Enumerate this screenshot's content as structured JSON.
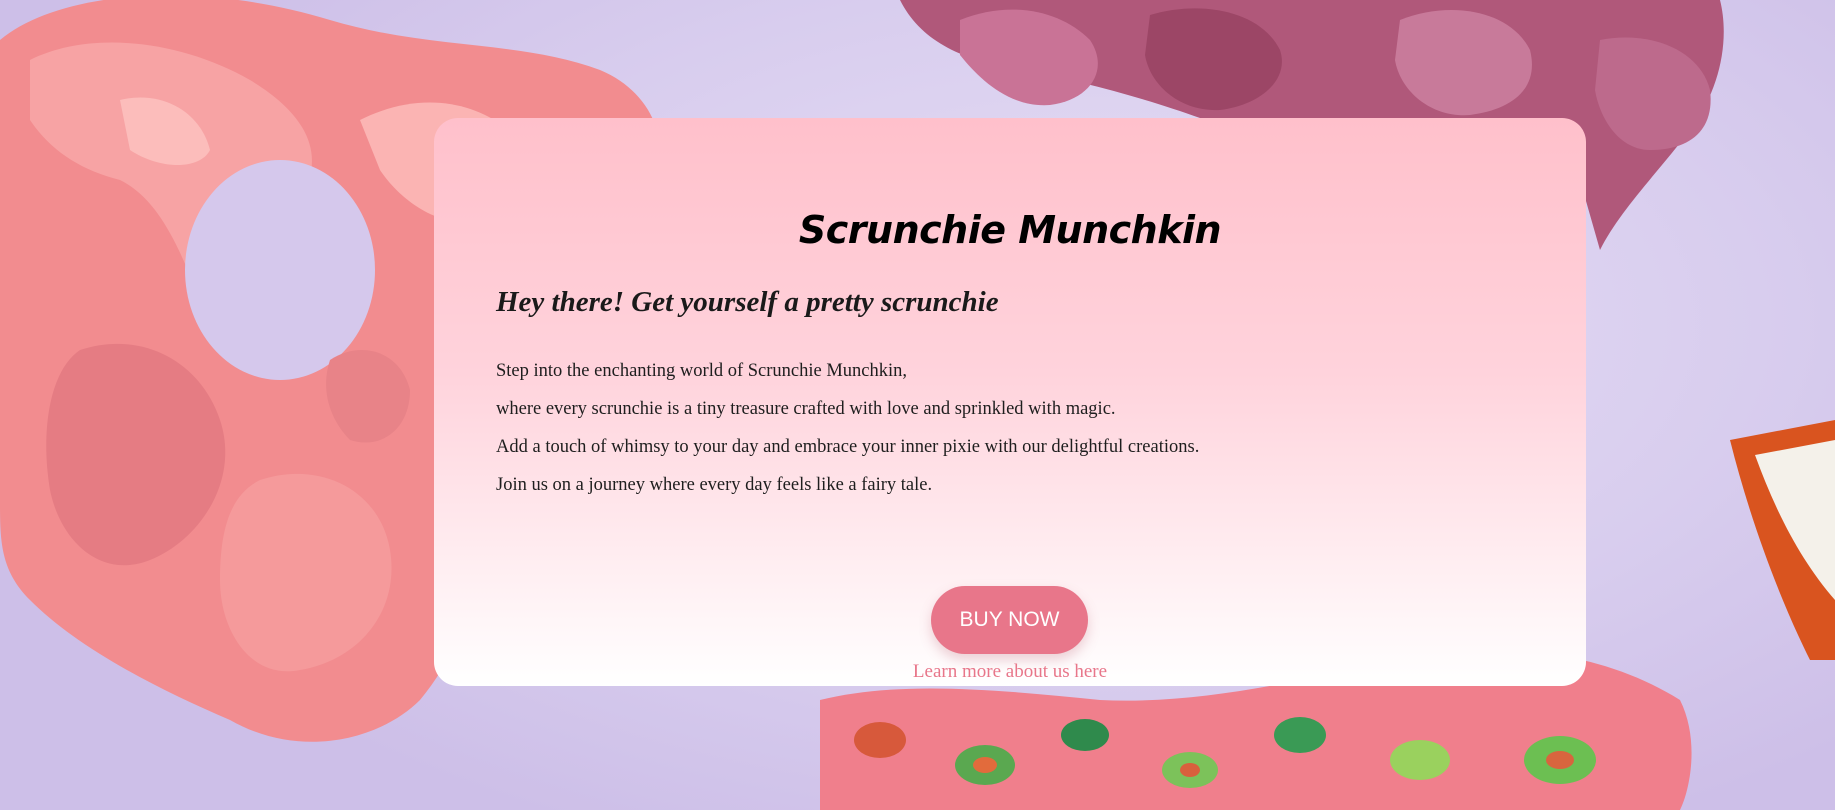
{
  "hero": {
    "title": "Scrunchie Munchkin",
    "subtitle": "Hey there! Get yourself a pretty scrunchie",
    "paragraphs": [
      "Step into the enchanting world of Scrunchie Munchkin,",
      "where every scrunchie is a tiny treasure crafted with love and sprinkled with magic.",
      "Add a touch of whimsy to your day and embrace your inner pixie with our delightful creations.",
      "Join us on a journey where every day feels like a fairy tale."
    ],
    "buy_label": "BUY NOW",
    "learn_more_label": "Learn more about us here"
  },
  "colors": {
    "accent": "#e8768a",
    "card_top": "#ffc0cb",
    "card_bottom": "#ffffff",
    "background": "#d9d0ee"
  }
}
